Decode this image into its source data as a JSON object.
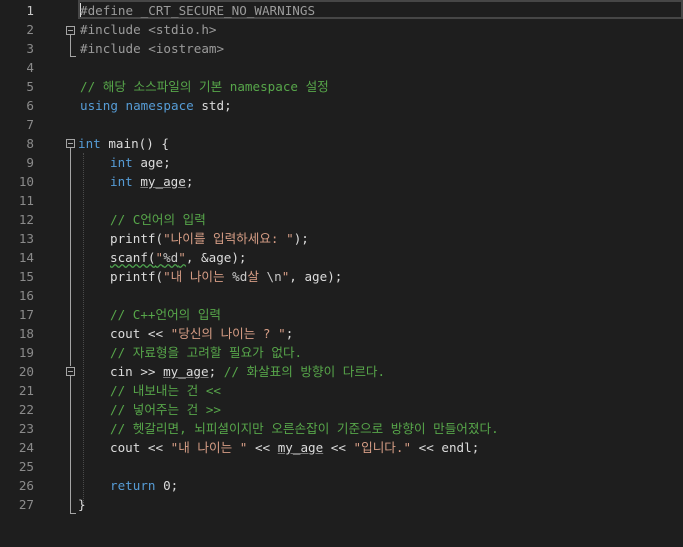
{
  "editor": {
    "line_numbers": [
      "1",
      "2",
      "3",
      "4",
      "5",
      "6",
      "7",
      "8",
      "9",
      "10",
      "11",
      "12",
      "13",
      "14",
      "15",
      "16",
      "17",
      "18",
      "19",
      "20",
      "21",
      "22",
      "23",
      "24",
      "25",
      "26",
      "27"
    ],
    "active_line": "1",
    "code": {
      "l1": "#define _CRT_SECURE_NO_WARNINGS",
      "l2": "#include <stdio.h>",
      "l3": "#include <iostream>",
      "l5": "// 해당 소스파일의 기본 namespace 설정",
      "l6_kw1": "using",
      "l6_kw2": "namespace",
      "l6_rest": " std;",
      "l8_kw": "int",
      "l8_rest": " main() {",
      "l9_kw": "int",
      "l9_rest": " age;",
      "l10_kw": "int",
      "l10_var": "my_age",
      "l10_semi": ";",
      "l12": "// C언어의 입력",
      "l13_fn": "printf(",
      "l13_str": "\"나이를 입력하세요: \"",
      "l13_end": ");",
      "l14_fn": "scanf(",
      "l14_str1": "\"",
      "l14_fmt": "%d",
      "l14_str2": "\"",
      "l14_rest": ", &age);",
      "l15_fn": "printf(",
      "l15_str1": "\"내 나이는 ",
      "l15_fmt": "%d",
      "l15_str2": "살 ",
      "l15_esc": "\\n",
      "l15_str3": "\"",
      "l15_rest": ", age);",
      "l17": "// C++언어의 입력",
      "l18_pre": "cout << ",
      "l18_str": "\"당신의 나이는 ? \"",
      "l18_end": ";",
      "l19": "// 자료형을 고려할 필요가 없다.",
      "l20_pre": "cin >> ",
      "l20_var": "my_age",
      "l20_semi": "; ",
      "l20_cm": "// 화살표의 방향이 다르다.",
      "l21": "// 내보내는 건 <<",
      "l22": "// 넣어주는 건 >>",
      "l23": "// 헷갈리면, 뇌피셜이지만 오른손잡이 기준으로 방향이 만들어졌다.",
      "l24_pre": "cout << ",
      "l24_str1": "\"내 나이는 \"",
      "l24_mid1": " << ",
      "l24_var": "my_age",
      "l24_mid2": " << ",
      "l24_str2": "\"입니다.\"",
      "l24_end": " << endl;",
      "l26_kw": "return",
      "l26_rest": " 0;",
      "l27": "}"
    }
  }
}
